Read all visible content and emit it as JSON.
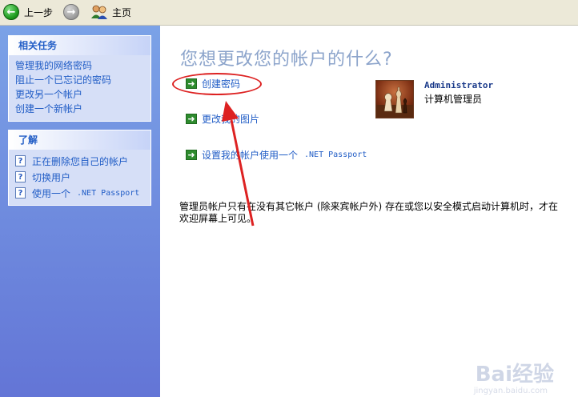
{
  "toolbar": {
    "back_label": "上一步",
    "home_label": "主页"
  },
  "sidebar": {
    "related_tasks": {
      "title": "相关任务",
      "items": [
        {
          "label": "管理我的网络密码"
        },
        {
          "label": "阻止一个已忘记的密码"
        },
        {
          "label": "更改另一个帐户"
        },
        {
          "label": "创建一个新帐户"
        }
      ]
    },
    "learn": {
      "title": "了解",
      "items": [
        {
          "label": "正在删除您自己的帐户"
        },
        {
          "label": "切换用户"
        },
        {
          "label_prefix": "使用一个",
          "label_suffix": ".NET Passport"
        }
      ]
    }
  },
  "main": {
    "title": "您想更改您的帐户的什么?",
    "actions": [
      {
        "label": "创建密码"
      },
      {
        "label": "更改我的图片"
      },
      {
        "label_prefix": "设置我的帐户使用一个",
        "label_suffix": ".NET Passport"
      }
    ],
    "user": {
      "name": "Administrator",
      "role": "计算机管理员"
    },
    "note": "管理员帐户只有在没有其它帐户 (除来宾帐户外) 存在或您以安全模式启动计算机时，才在欢迎屏幕上可见。"
  },
  "watermark": {
    "brand": "Bai经验",
    "url": "jingyan.baidu.com"
  },
  "colors": {
    "sidebar_top": "#7BA2E7",
    "sidebar_bottom": "#6375D6",
    "link": "#215DC6",
    "title": "#8CA4CB",
    "annotation": "#DD2222"
  }
}
